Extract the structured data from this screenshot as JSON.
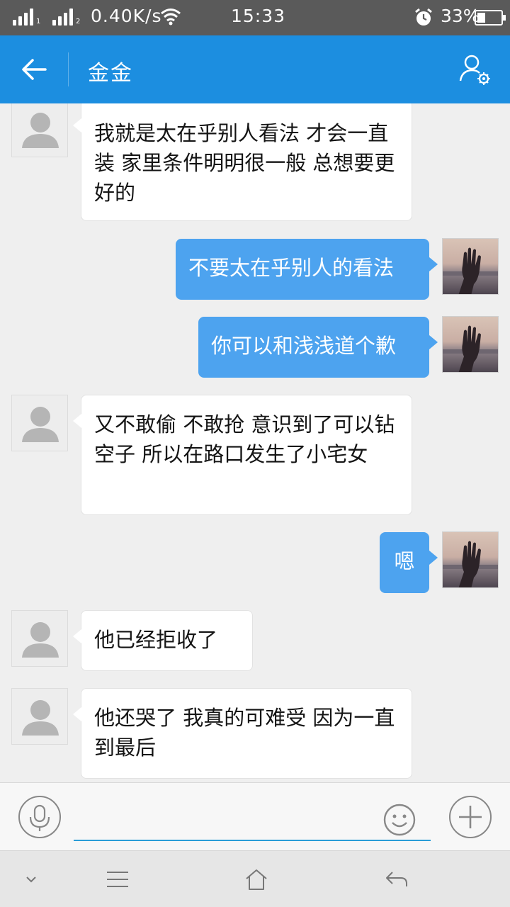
{
  "status_bar": {
    "sim1_label": "1",
    "sim2_label": "2",
    "net_speed": "0.40K/s",
    "time": "15:33",
    "battery_percent": "33%",
    "battery_level": 0.33,
    "icons": [
      "signal-icon",
      "wifi-icon",
      "alarm-icon",
      "battery-icon"
    ]
  },
  "header": {
    "title": "⾦⾦",
    "back_icon": "arrow-left-icon",
    "profile_icon": "user-settings-icon"
  },
  "messages": [
    {
      "side": "left",
      "text": "我就是太在乎别人看法 才会一直装 家里条件明明很一般 总想要更好的"
    },
    {
      "side": "right",
      "text": "不要太在乎别人的看法"
    },
    {
      "side": "right",
      "text": "你可以和浅浅道个歉"
    },
    {
      "side": "left",
      "text": "又不敢偷 不敢抢 意识到了可以钻空子 所以在路口发生了小宅女"
    },
    {
      "side": "right",
      "text": "嗯"
    },
    {
      "side": "left",
      "text": "他已经拒收了"
    },
    {
      "side": "left",
      "text": "他还哭了  我真的可难受 因为一直到最后"
    }
  ],
  "input_bar": {
    "placeholder": "",
    "value": "",
    "icons": [
      "microphone-icon",
      "emoji-icon",
      "plus-icon"
    ]
  },
  "nav_bar": {
    "icons": [
      "chevron-down-icon",
      "menu-icon",
      "home-icon",
      "back-icon"
    ]
  },
  "colors": {
    "header": "#1c8ee0",
    "outgoing_bubble": "#4da3ef",
    "incoming_bubble": "#ffffff",
    "background": "#efefef"
  }
}
